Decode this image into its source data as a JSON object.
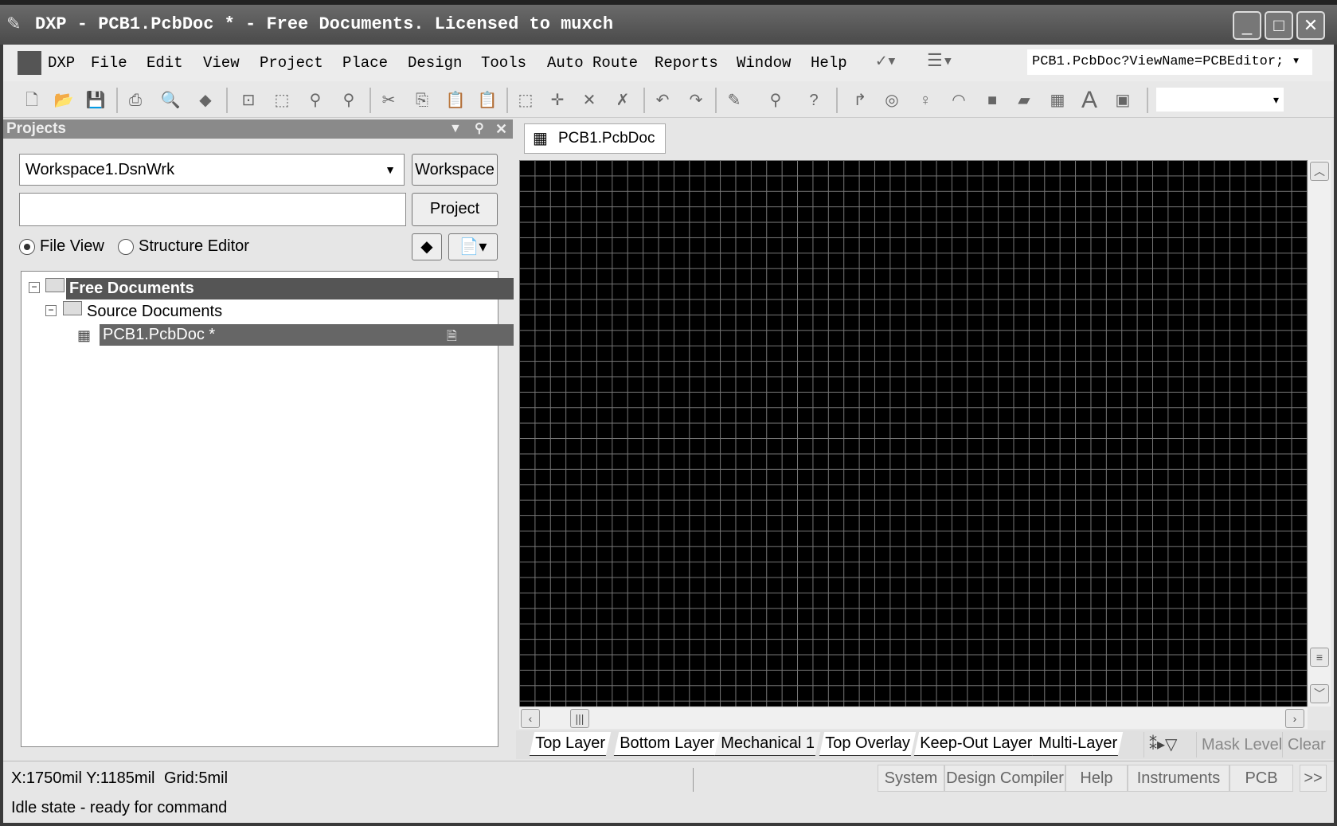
{
  "window": {
    "title": "DXP - PCB1.PcbDoc * - Free Documents. Licensed to muxch",
    "minimize": "_",
    "maximize": "□",
    "close": "✕"
  },
  "menu": [
    "DXP",
    "File",
    "Edit",
    "View",
    "Project",
    "Place",
    "Design",
    "Tools",
    "Auto Route",
    "Reports",
    "Window",
    "Help"
  ],
  "address": "PCB1.PcbDoc?ViewName=PCBEditor;",
  "projects_panel": {
    "title": "Projects",
    "workspace_value": "Workspace1.DsnWrk",
    "workspace_button": "Workspace",
    "project_input": "",
    "project_button": "Project",
    "radio_file_view": "File View",
    "radio_structure": "Structure Editor",
    "tree": [
      {
        "label": "Free Documents"
      },
      {
        "label": "Source Documents"
      },
      {
        "label": "PCB1.PcbDoc *"
      }
    ]
  },
  "doc_tab": "PCB1.PcbDoc *",
  "layers": [
    "Top Layer",
    "Bottom Layer",
    "Mechanical 1",
    "Top Overlay",
    "Keep-Out Layer",
    "Multi-Layer"
  ],
  "layer_buttons": {
    "mask": "Mask Level",
    "clear": "Clear"
  },
  "status": {
    "coords": "X:1750mil Y:1185mil",
    "grid": "Grid:5mil",
    "state": "Idle state - ready for command"
  },
  "panels": [
    "System",
    "Design Compiler",
    "Help",
    "Instruments",
    "PCB",
    ">>"
  ]
}
